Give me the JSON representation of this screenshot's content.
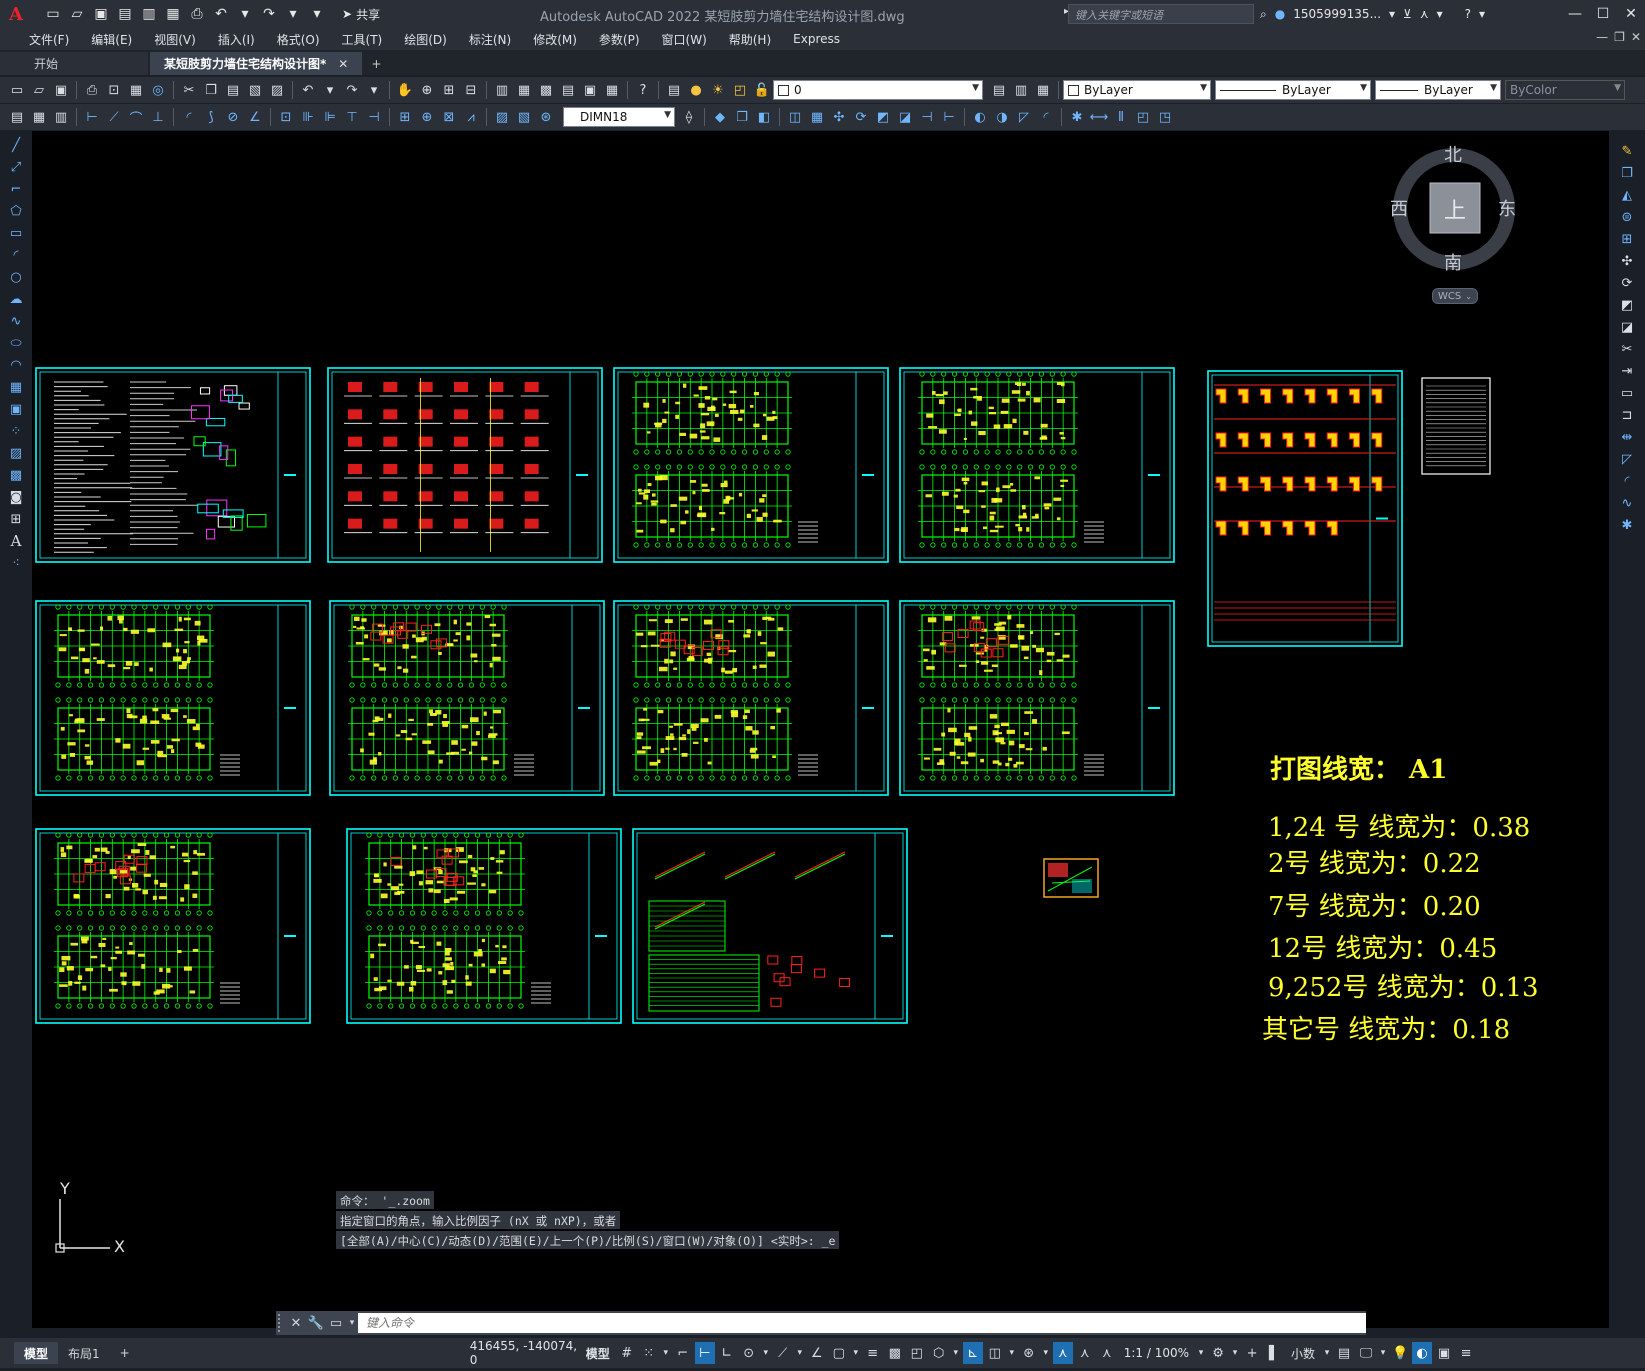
{
  "app": {
    "logo": "A",
    "title": "Autodesk AutoCAD 2022    某短肢剪力墙住宅结构设计图.dwg",
    "search_placeholder": "键入关键字或短语",
    "user": "1505999135...",
    "share": "共享"
  },
  "menu": [
    "文件(F)",
    "编辑(E)",
    "视图(V)",
    "插入(I)",
    "格式(O)",
    "工具(T)",
    "绘图(D)",
    "标注(N)",
    "修改(M)",
    "参数(P)",
    "窗口(W)",
    "帮助(H)",
    "Express"
  ],
  "tabs": {
    "start": "开始",
    "doc": "某短肢剪力墙住宅结构设计图*"
  },
  "toolbar": {
    "layer": "0",
    "color": "ByLayer",
    "linetype": "ByLayer",
    "lineweight": "ByLayer",
    "plotstyle": "ByColor",
    "dimstyle": "DIMN18"
  },
  "viewcube": {
    "north": "北",
    "south": "南",
    "east": "东",
    "west": "西",
    "face": "上",
    "wcs": "WCS"
  },
  "ucs": {
    "y": "Y",
    "x": "X"
  },
  "notes": {
    "title": "打图线宽：  A1",
    "lines": [
      "1,24 号    线宽为：0.38",
      "2号    线宽为：0.22",
      "7号    线宽为：0.20",
      "12号    线宽为：0.45",
      "9,252号    线宽为：0.13",
      "其它号    线宽为：0.18"
    ]
  },
  "command": {
    "history": [
      "命令： '_.zoom",
      "指定窗口的角点，输入比例因子 (nX 或 nXP)，或者",
      "[全部(A)/中心(C)/动态(D)/范围(E)/上一个(P)/比例(S)/窗口(W)/对象(O)] <实时>: _e"
    ],
    "placeholder": "键入命令"
  },
  "status": {
    "model_tab": "模型",
    "layout_tab": "布局1",
    "coords": "416455, -140074, 0",
    "space": "模型",
    "scale": "1:1 / 100%",
    "units": "小数"
  },
  "colors": {
    "sheet_border": "#00ffff",
    "plan_green": "#00ff00",
    "annotation_yellow": "#ffff2e",
    "red": "#ff2020",
    "canvas": "#000000"
  }
}
